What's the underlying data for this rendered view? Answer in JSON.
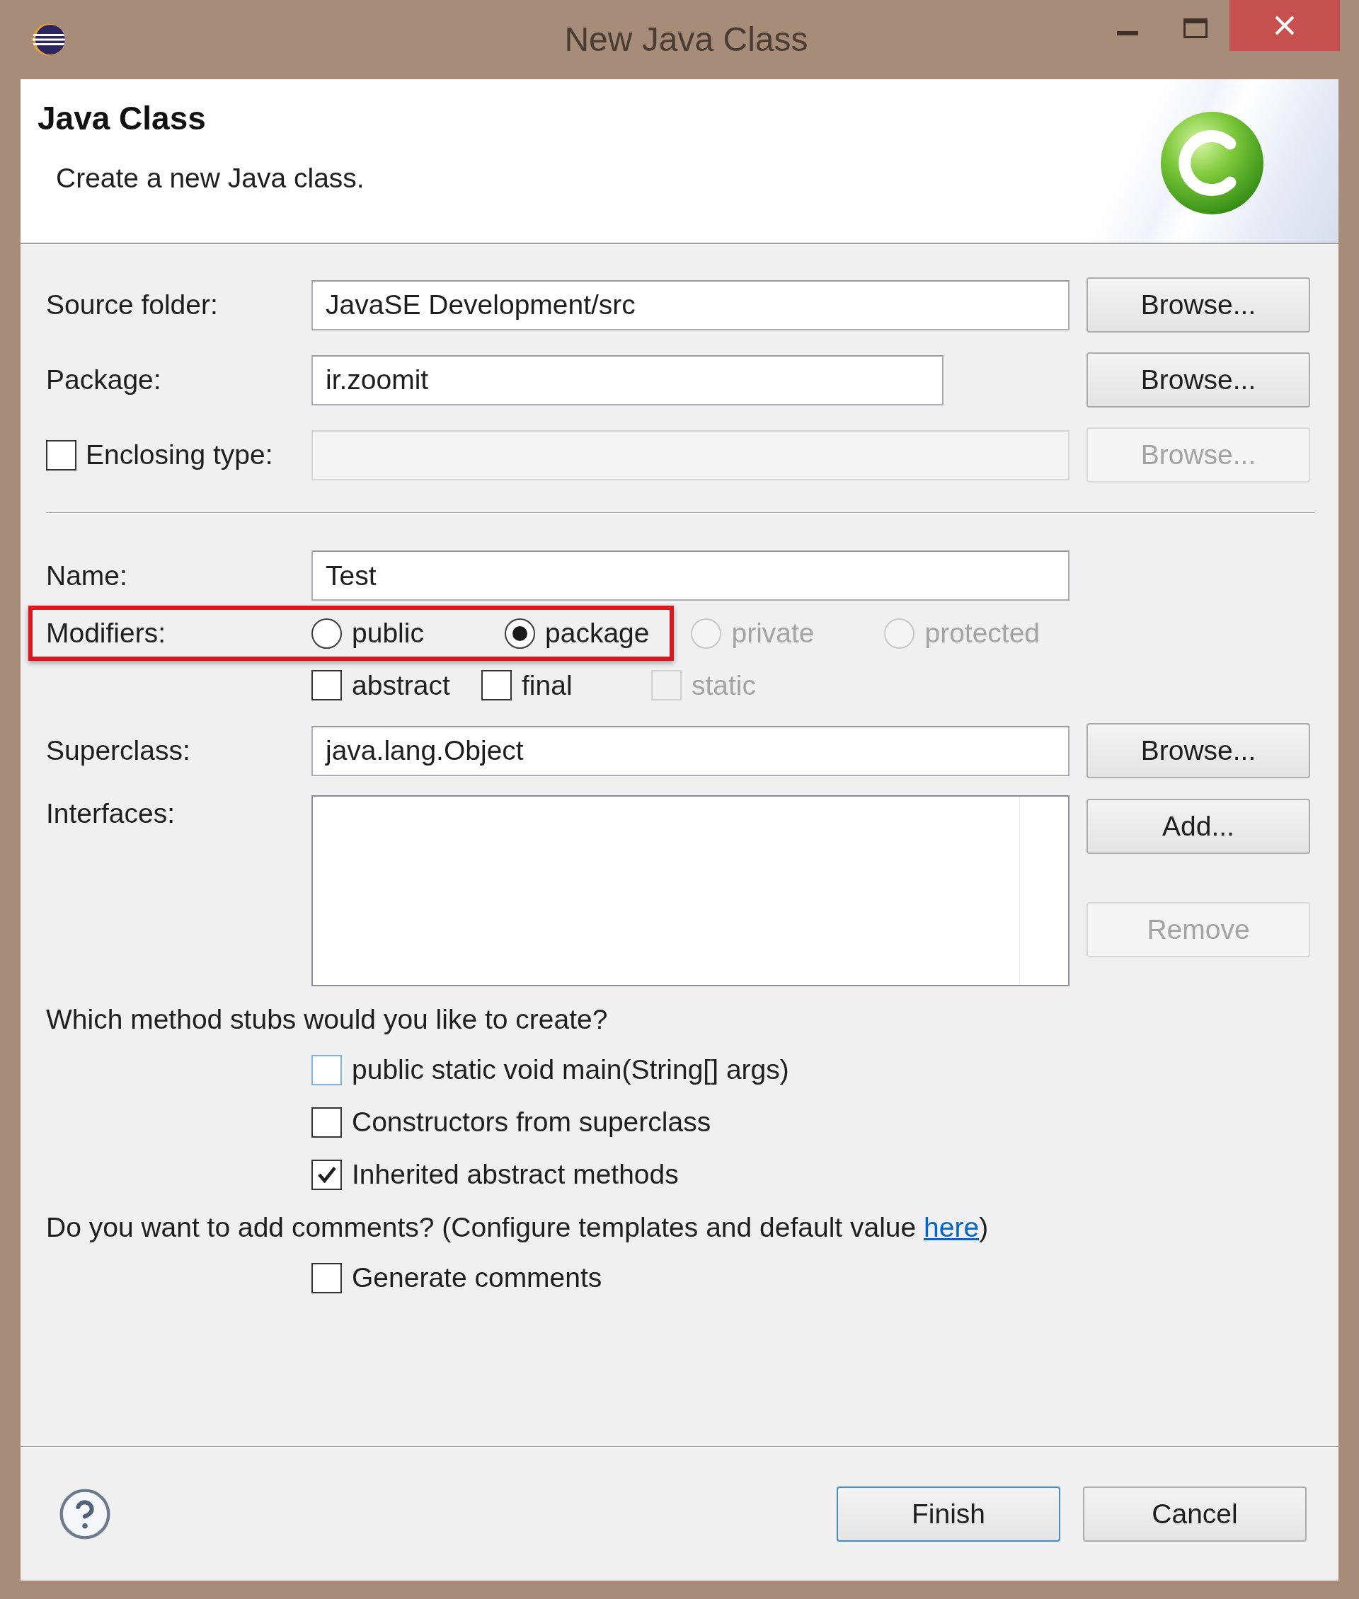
{
  "window": {
    "title": "New Java Class"
  },
  "header": {
    "title": "Java Class",
    "description": "Create a new Java class."
  },
  "source_folder": {
    "label": "Source folder:",
    "value": "JavaSE Development/src",
    "button": {
      "label": "Browse...",
      "disabled": false
    }
  },
  "package": {
    "label": "Package:",
    "value": "ir.zoomit",
    "button": {
      "label": "Browse...",
      "disabled": false
    }
  },
  "enclosing_type": {
    "label": "Enclosing type:",
    "checked": false,
    "field": {
      "disabled": true
    },
    "button": {
      "label": "Browse...",
      "disabled": true
    }
  },
  "name": {
    "label": "Name:",
    "value": "Test"
  },
  "modifiers": {
    "frame": {
      "highlighted": true,
      "label": "Modifiers:",
      "access": [
        {
          "label": "public",
          "selected": false,
          "disabled": false
        },
        {
          "label": "package",
          "selected": true,
          "disabled": false
        }
      ]
    },
    "access": [
      {
        "label": "private",
        "selected": false,
        "disabled": true
      },
      {
        "label": "protected",
        "selected": false,
        "disabled": true
      }
    ],
    "flags": [
      {
        "label": "abstract",
        "checked": false,
        "disabled": false
      },
      {
        "label": "final",
        "checked": false,
        "disabled": false
      },
      {
        "label": "static",
        "checked": false,
        "disabled": true
      }
    ]
  },
  "superclass": {
    "label": "Superclass:",
    "value": "java.lang.Object",
    "button": {
      "label": "Browse...",
      "disabled": false
    }
  },
  "interfaces": {
    "label": "Interfaces:",
    "buttons": [
      {
        "label": "Add...",
        "disabled": false
      },
      {
        "label": "Remove",
        "disabled": true
      }
    ]
  },
  "method_stubs": {
    "question": "Which method stubs would you like to create?",
    "options": [
      {
        "label": "public static void main(String[] args)",
        "checked": false,
        "focused": true
      },
      {
        "label": "Constructors from superclass",
        "checked": false,
        "focused": false
      },
      {
        "label": "Inherited abstract methods",
        "checked": true,
        "focused": false
      }
    ]
  },
  "comments": {
    "question": "Do you want to add comments? (Configure templates and default value",
    "link": "here",
    "question_end": ")",
    "options": [
      {
        "label": "Generate comments",
        "checked": false,
        "focused": false
      }
    ]
  },
  "footer": {
    "buttons": [
      {
        "label": "Finish",
        "default": true
      },
      {
        "label": "Cancel",
        "default": false
      }
    ]
  }
}
